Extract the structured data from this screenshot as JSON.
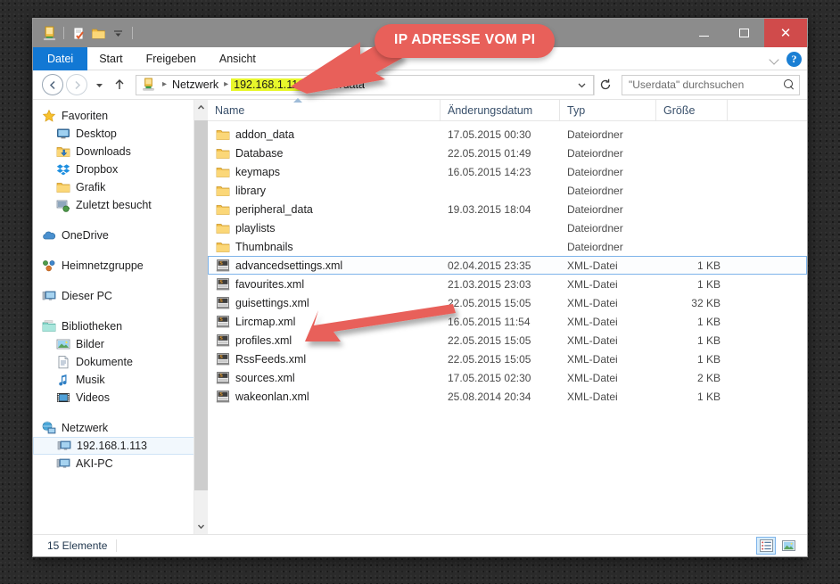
{
  "window": {
    "quick_access": [
      "network-computer-icon",
      "properties-icon",
      "new-folder-icon",
      "customize-dropdown-icon"
    ],
    "controls": {
      "minimize_label": "–",
      "maximize_label": "☐",
      "close_label": "✕"
    }
  },
  "ribbon": {
    "tabs": [
      {
        "label": "Datei",
        "active": true
      },
      {
        "label": "Start",
        "active": false
      },
      {
        "label": "Freigeben",
        "active": false
      },
      {
        "label": "Ansicht",
        "active": false
      }
    ],
    "collapse_icon": "chevron-down-icon",
    "help_label": "?"
  },
  "address": {
    "back_label": "←",
    "forward_label": "→",
    "recent_label": "▾",
    "up_label": "↑",
    "icon": "network-computer-icon",
    "separator": "▸",
    "crumbs": [
      {
        "label": "Netzwerk",
        "highlight": false
      },
      {
        "label": "192.168.1.113",
        "highlight": true
      },
      {
        "label": "Userdata",
        "highlight": false
      }
    ],
    "dropdown_label": "⌄",
    "refresh_label": "↻",
    "highlight_color": "#e8f72b"
  },
  "search": {
    "placeholder": "\"Userdata\" durchsuchen",
    "value": "",
    "icon": "search-icon"
  },
  "sidebar": {
    "groups": [
      {
        "header": {
          "label": "Favoriten",
          "icon": "star-icon"
        },
        "items": [
          {
            "label": "Desktop",
            "icon": "monitor-icon"
          },
          {
            "label": "Downloads",
            "icon": "downloads-folder-icon"
          },
          {
            "label": "Dropbox",
            "icon": "dropbox-icon"
          },
          {
            "label": "Grafik",
            "icon": "folder-icon"
          },
          {
            "label": "Zuletzt besucht",
            "icon": "recent-places-icon"
          }
        ]
      },
      {
        "header": {
          "label": "OneDrive",
          "icon": "cloud-icon"
        },
        "items": []
      },
      {
        "header": {
          "label": "Heimnetzgruppe",
          "icon": "homegroup-icon"
        },
        "items": []
      },
      {
        "header": {
          "label": "Dieser PC",
          "icon": "computer-icon"
        },
        "items": []
      },
      {
        "header": {
          "label": "Bibliotheken",
          "icon": "libraries-icon"
        },
        "items": [
          {
            "label": "Bilder",
            "icon": "pictures-icon"
          },
          {
            "label": "Dokumente",
            "icon": "documents-icon"
          },
          {
            "label": "Musik",
            "icon": "music-icon"
          },
          {
            "label": "Videos",
            "icon": "videos-icon"
          }
        ]
      },
      {
        "header": {
          "label": "Netzwerk",
          "icon": "network-icon"
        },
        "items": [
          {
            "label": "192.168.1.113",
            "icon": "computer-icon",
            "selected": true
          },
          {
            "label": "AKI-PC",
            "icon": "computer-icon",
            "selected": false
          }
        ]
      }
    ],
    "scroll_up_label": "⌃",
    "scroll_down_label": "⌄"
  },
  "filelist": {
    "columns": [
      {
        "key": "name",
        "label": "Name",
        "sorted": true
      },
      {
        "key": "date",
        "label": "Änderungsdatum",
        "sorted": false
      },
      {
        "key": "type",
        "label": "Typ",
        "sorted": false
      },
      {
        "key": "size",
        "label": "Größe",
        "sorted": false
      }
    ],
    "rows": [
      {
        "name": "addon_data",
        "date": "17.05.2015 00:30",
        "type": "Dateiordner",
        "size": "",
        "icon": "folder-icon",
        "selected": false
      },
      {
        "name": "Database",
        "date": "22.05.2015 01:49",
        "type": "Dateiordner",
        "size": "",
        "icon": "folder-icon",
        "selected": false
      },
      {
        "name": "keymaps",
        "date": "16.05.2015 14:23",
        "type": "Dateiordner",
        "size": "",
        "icon": "folder-icon",
        "selected": false
      },
      {
        "name": "library",
        "date": "",
        "type": "Dateiordner",
        "size": "",
        "icon": "folder-icon",
        "selected": false
      },
      {
        "name": "peripheral_data",
        "date": "19.03.2015 18:04",
        "type": "Dateiordner",
        "size": "",
        "icon": "folder-icon",
        "selected": false
      },
      {
        "name": "playlists",
        "date": "",
        "type": "Dateiordner",
        "size": "",
        "icon": "folder-icon",
        "selected": false
      },
      {
        "name": "Thumbnails",
        "date": "",
        "type": "Dateiordner",
        "size": "",
        "icon": "folder-icon",
        "selected": false
      },
      {
        "name": "advancedsettings.xml",
        "date": "02.04.2015 23:35",
        "type": "XML-Datei",
        "size": "1 KB",
        "icon": "xml-file-icon",
        "selected": true
      },
      {
        "name": "favourites.xml",
        "date": "21.03.2015 23:03",
        "type": "XML-Datei",
        "size": "1 KB",
        "icon": "xml-file-icon",
        "selected": false
      },
      {
        "name": "guisettings.xml",
        "date": "22.05.2015 15:05",
        "type": "XML-Datei",
        "size": "32 KB",
        "icon": "xml-file-icon",
        "selected": false
      },
      {
        "name": "Lircmap.xml",
        "date": "16.05.2015 11:54",
        "type": "XML-Datei",
        "size": "1 KB",
        "icon": "xml-file-icon",
        "selected": false
      },
      {
        "name": "profiles.xml",
        "date": "22.05.2015 15:05",
        "type": "XML-Datei",
        "size": "1 KB",
        "icon": "xml-file-icon",
        "selected": false
      },
      {
        "name": "RssFeeds.xml",
        "date": "22.05.2015 15:05",
        "type": "XML-Datei",
        "size": "1 KB",
        "icon": "xml-file-icon",
        "selected": false
      },
      {
        "name": "sources.xml",
        "date": "17.05.2015 02:30",
        "type": "XML-Datei",
        "size": "2 KB",
        "icon": "xml-file-icon",
        "selected": false
      },
      {
        "name": "wakeonlan.xml",
        "date": "25.08.2014 20:34",
        "type": "XML-Datei",
        "size": "1 KB",
        "icon": "xml-file-icon",
        "selected": false
      }
    ]
  },
  "statusbar": {
    "item_count": "15 Elemente",
    "views": [
      {
        "name": "details-view",
        "active": true
      },
      {
        "name": "large-icons-view",
        "active": false
      }
    ]
  },
  "annotations": {
    "callout_text": "IP ADRESSE VOM PI",
    "callout_color": "#e8605a",
    "arrow_color": "#e8605a",
    "arrows": [
      {
        "name": "arrow-to-ip-address",
        "points_to": "192.168.1.113"
      },
      {
        "name": "arrow-to-lircmap",
        "points_to": "Lircmap.xml"
      }
    ]
  }
}
